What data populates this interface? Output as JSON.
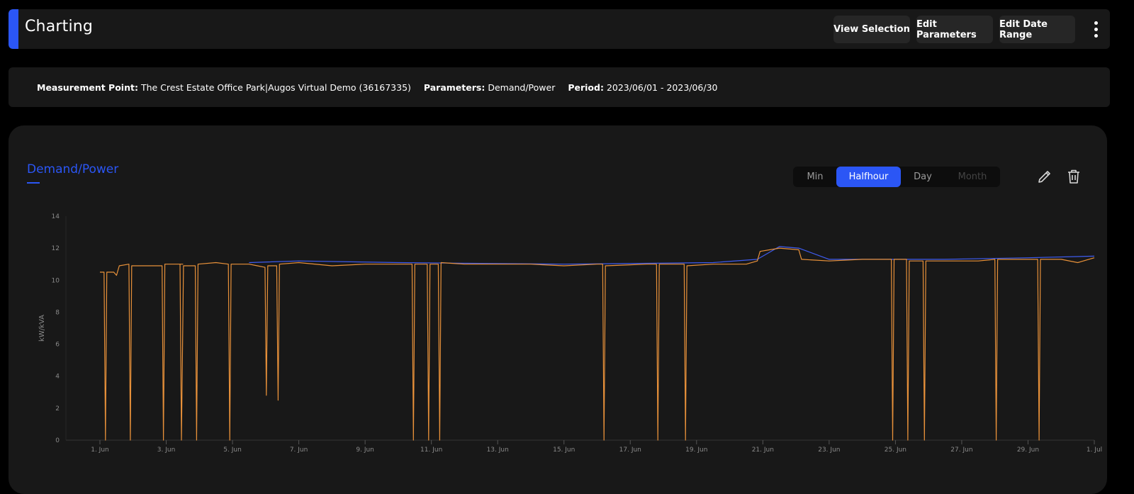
{
  "header": {
    "title": "Charting",
    "buttons": {
      "view_selection": "View Selection",
      "edit_parameters": "Edit Parameters",
      "edit_date_range": "Edit Date Range"
    }
  },
  "info": {
    "measurement_point_label": "Measurement Point:",
    "measurement_point_value": "The Crest Estate Office Park|Augos Virtual Demo (36167335)",
    "parameters_label": "Parameters:",
    "parameters_value": "Demand/Power",
    "period_label": "Period:",
    "period_value": "2023/06/01 - 2023/06/30"
  },
  "chart_panel": {
    "title": "Demand/Power",
    "interval_options": [
      {
        "label": "Min",
        "state": "enabled"
      },
      {
        "label": "Halfhour",
        "state": "selected"
      },
      {
        "label": "Day",
        "state": "enabled"
      },
      {
        "label": "Month",
        "state": "disabled"
      }
    ],
    "icons": [
      "pencil-icon",
      "trash-icon"
    ]
  },
  "colors": {
    "accent": "#2b56f5",
    "series_orange": "#e8913a",
    "series_blue": "#3f5cf0",
    "panel_bg": "#181818",
    "page_bg": "#000000"
  },
  "chart_data": {
    "type": "line",
    "ylabel": "kW/kVA",
    "ylim": [
      0,
      14
    ],
    "yticks": [
      0,
      2,
      4,
      6,
      8,
      10,
      12,
      14
    ],
    "xlim": [
      "2023-06-01",
      "2023-07-01"
    ],
    "xtick_labels": [
      "1. Jun",
      "3. Jun",
      "5. Jun",
      "7. Jun",
      "9. Jun",
      "11. Jun",
      "13. Jun",
      "15. Jun",
      "17. Jun",
      "19. Jun",
      "21. Jun",
      "23. Jun",
      "25. Jun",
      "27. Jun",
      "29. Jun",
      "1. Jul"
    ],
    "xtick_dates": [
      "2023-06-01",
      "2023-06-03",
      "2023-06-05",
      "2023-06-07",
      "2023-06-09",
      "2023-06-11",
      "2023-06-13",
      "2023-06-15",
      "2023-06-17",
      "2023-06-19",
      "2023-06-21",
      "2023-06-23",
      "2023-06-25",
      "2023-06-27",
      "2023-06-29",
      "2023-07-01"
    ],
    "grid": false,
    "legend": "none",
    "series": [
      {
        "color": "#e8913a",
        "points": [
          [
            "2023-06-01 00:00",
            10.5
          ],
          [
            "2023-06-01 03:00",
            10.5
          ],
          [
            "2023-06-01 04:00",
            0
          ],
          [
            "2023-06-01 05:00",
            10.5
          ],
          [
            "2023-06-01 10:00",
            10.5
          ],
          [
            "2023-06-01 12:00",
            10.3
          ],
          [
            "2023-06-01 14:00",
            10.9
          ],
          [
            "2023-06-01 21:00",
            11.0
          ],
          [
            "2023-06-01 22:00",
            0
          ],
          [
            "2023-06-01 23:00",
            10.9
          ],
          [
            "2023-06-02 12:00",
            10.9
          ],
          [
            "2023-06-02 21:00",
            10.9
          ],
          [
            "2023-06-02 22:00",
            0
          ],
          [
            "2023-06-02 23:00",
            11.0
          ],
          [
            "2023-06-03 12:00",
            11.0
          ],
          [
            "2023-06-03 10:00",
            11.0
          ],
          [
            "2023-06-03 11:00",
            0
          ],
          [
            "2023-06-03 12:30",
            10.9
          ],
          [
            "2023-06-03 21:00",
            10.9
          ],
          [
            "2023-06-03 22:00",
            0
          ],
          [
            "2023-06-03 23:00",
            11.0
          ],
          [
            "2023-06-04 12:00",
            11.1
          ],
          [
            "2023-06-04 21:00",
            11.0
          ],
          [
            "2023-06-04 22:00",
            0
          ],
          [
            "2023-06-04 23:00",
            11.0
          ],
          [
            "2023-06-05 12:00",
            11.0
          ],
          [
            "2023-06-05 12:00",
            11.0
          ],
          [
            "2023-06-05 18:00",
            10.9
          ],
          [
            "2023-06-05 23:30",
            10.8
          ],
          [
            "2023-06-06 00:30",
            2.8
          ],
          [
            "2023-06-06 01:30",
            10.9
          ],
          [
            "2023-06-06 08:00",
            10.9
          ],
          [
            "2023-06-06 09:00",
            2.5
          ],
          [
            "2023-06-06 10:00",
            11.0
          ],
          [
            "2023-06-07 00:00",
            11.1
          ],
          [
            "2023-06-08 00:00",
            10.9
          ],
          [
            "2023-06-09 00:00",
            11.0
          ],
          [
            "2023-06-10 00:00",
            11.0
          ],
          [
            "2023-06-10 10:00",
            11.0
          ],
          [
            "2023-06-10 11:00",
            0
          ],
          [
            "2023-06-10 12:00",
            11.0
          ],
          [
            "2023-06-10 21:00",
            11.0
          ],
          [
            "2023-06-10 22:00",
            0
          ],
          [
            "2023-06-10 23:00",
            11.0
          ],
          [
            "2023-06-11 05:00",
            11.0
          ],
          [
            "2023-06-11 06:00",
            0
          ],
          [
            "2023-06-11 07:00",
            11.1
          ],
          [
            "2023-06-12 00:00",
            11.0
          ],
          [
            "2023-06-13 00:00",
            11.0
          ],
          [
            "2023-06-14 00:00",
            11.0
          ],
          [
            "2023-06-15 00:00",
            10.9
          ],
          [
            "2023-06-16 00:00",
            11.0
          ],
          [
            "2023-06-16 04:00",
            11.0
          ],
          [
            "2023-06-16 05:00",
            0
          ],
          [
            "2023-06-16 06:00",
            10.9
          ],
          [
            "2023-06-17 12:00",
            11.0
          ],
          [
            "2023-06-17 19:00",
            11.0
          ],
          [
            "2023-06-17 20:00",
            0
          ],
          [
            "2023-06-17 21:00",
            11.0
          ],
          [
            "2023-06-18 15:00",
            11.0
          ],
          [
            "2023-06-18 16:00",
            0
          ],
          [
            "2023-06-18 17:00",
            10.9
          ],
          [
            "2023-06-19 12:00",
            11.0
          ],
          [
            "2023-06-20 12:00",
            11.0
          ],
          [
            "2023-06-20 20:00",
            11.2
          ],
          [
            "2023-06-20 22:00",
            11.8
          ],
          [
            "2023-06-21 12:00",
            12.0
          ],
          [
            "2023-06-22 02:00",
            11.9
          ],
          [
            "2023-06-22 04:00",
            11.3
          ],
          [
            "2023-06-23 00:00",
            11.2
          ],
          [
            "2023-06-24 00:00",
            11.3
          ],
          [
            "2023-06-24 21:00",
            11.3
          ],
          [
            "2023-06-24 22:00",
            0
          ],
          [
            "2023-06-24 23:00",
            11.3
          ],
          [
            "2023-06-25 08:00",
            11.3
          ],
          [
            "2023-06-25 09:00",
            0
          ],
          [
            "2023-06-25 10:00",
            11.2
          ],
          [
            "2023-06-25 20:00",
            11.2
          ],
          [
            "2023-06-25 21:00",
            0
          ],
          [
            "2023-06-25 22:00",
            11.2
          ],
          [
            "2023-06-26 12:00",
            11.2
          ],
          [
            "2023-06-27 12:00",
            11.2
          ],
          [
            "2023-06-28 00:00",
            11.3
          ],
          [
            "2023-06-28 01:00",
            0
          ],
          [
            "2023-06-28 02:00",
            11.3
          ],
          [
            "2023-06-29 00:00",
            11.3
          ],
          [
            "2023-06-29 07:00",
            11.3
          ],
          [
            "2023-06-29 08:00",
            0
          ],
          [
            "2023-06-29 09:00",
            11.3
          ],
          [
            "2023-06-30 00:00",
            11.3
          ],
          [
            "2023-06-30 12:00",
            11.1
          ],
          [
            "2023-07-01 00:00",
            11.4
          ]
        ]
      },
      {
        "color": "#3f5cf0",
        "points": [
          [
            "2023-06-05 12:00",
            11.1
          ],
          [
            "2023-06-07 00:00",
            11.2
          ],
          [
            "2023-06-10 00:00",
            11.1
          ],
          [
            "2023-06-15 00:00",
            11.0
          ],
          [
            "2023-06-19 12:00",
            11.1
          ],
          [
            "2023-06-20 20:00",
            11.3
          ],
          [
            "2023-06-21 12:00",
            12.1
          ],
          [
            "2023-06-22 02:00",
            12.0
          ],
          [
            "2023-06-23 00:00",
            11.3
          ],
          [
            "2023-06-26 12:00",
            11.3
          ],
          [
            "2023-06-29 00:00",
            11.4
          ],
          [
            "2023-07-01 00:00",
            11.5
          ]
        ]
      }
    ]
  }
}
